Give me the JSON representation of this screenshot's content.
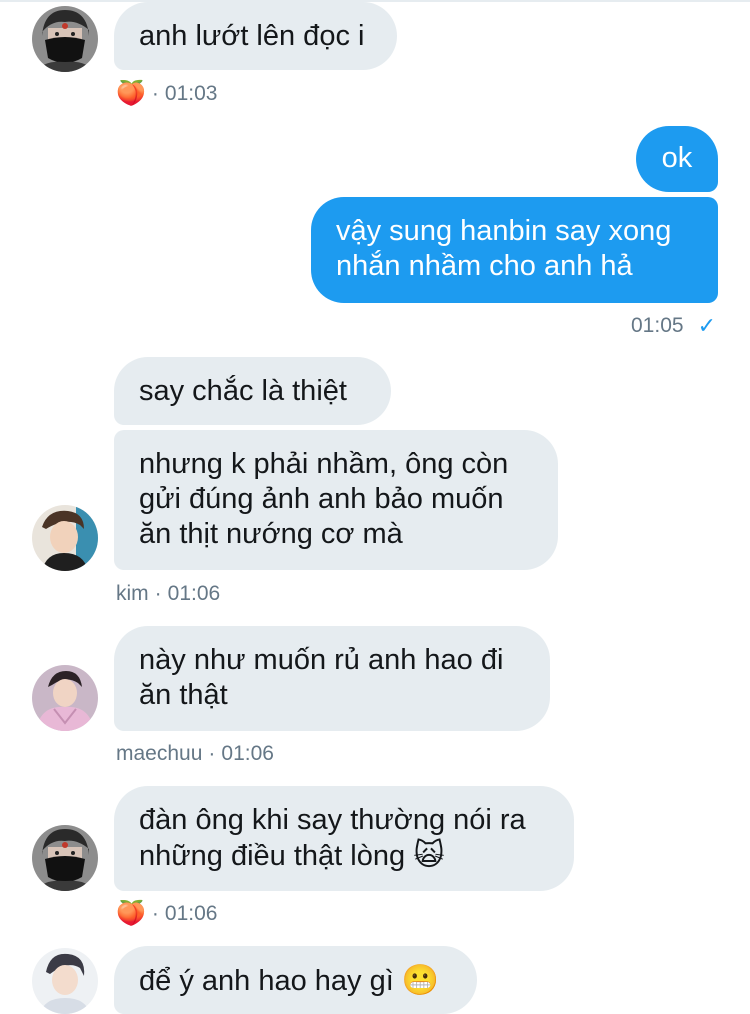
{
  "messages": [
    {
      "id": "m1",
      "text": "anh lướt lên đọc i"
    },
    {
      "id": "m2",
      "text": "ok"
    },
    {
      "id": "m3",
      "lines": [
        "vậy sung hanbin say xong",
        "nhắn nhầm cho anh hả"
      ]
    },
    {
      "id": "m4",
      "text": "say chắc là thiệt"
    },
    {
      "id": "m5",
      "lines": [
        "nhưng k phải nhầm, ông còn",
        "gửi đúng ảnh anh bảo muốn",
        "ăn thịt nướng cơ mà"
      ]
    },
    {
      "id": "m6",
      "lines": [
        "này như muốn rủ anh hao đi",
        "ăn thật"
      ]
    },
    {
      "id": "m7",
      "lines": [
        "đàn ông khi say thường nói ra",
        "những điều thật lòng"
      ],
      "emoji": "🙀"
    },
    {
      "id": "m8",
      "text": "để ý anh hao hay gì",
      "emoji": "😬"
    }
  ],
  "meta": {
    "g1": {
      "emoji": "🍑",
      "sep": "·",
      "time": "01:03"
    },
    "out": {
      "time": "01:05",
      "check": "✓"
    },
    "g3": {
      "name": "kim",
      "sep": "·",
      "time": "01:06"
    },
    "g4": {
      "name": "maechuu",
      "sep": "·",
      "time": "01:06"
    },
    "g5": {
      "emoji": "🍑",
      "sep": "·",
      "time": "01:06"
    }
  },
  "colors": {
    "outgoing": "#1d9bf0",
    "incoming": "#e6ecf0",
    "meta": "#657786"
  }
}
